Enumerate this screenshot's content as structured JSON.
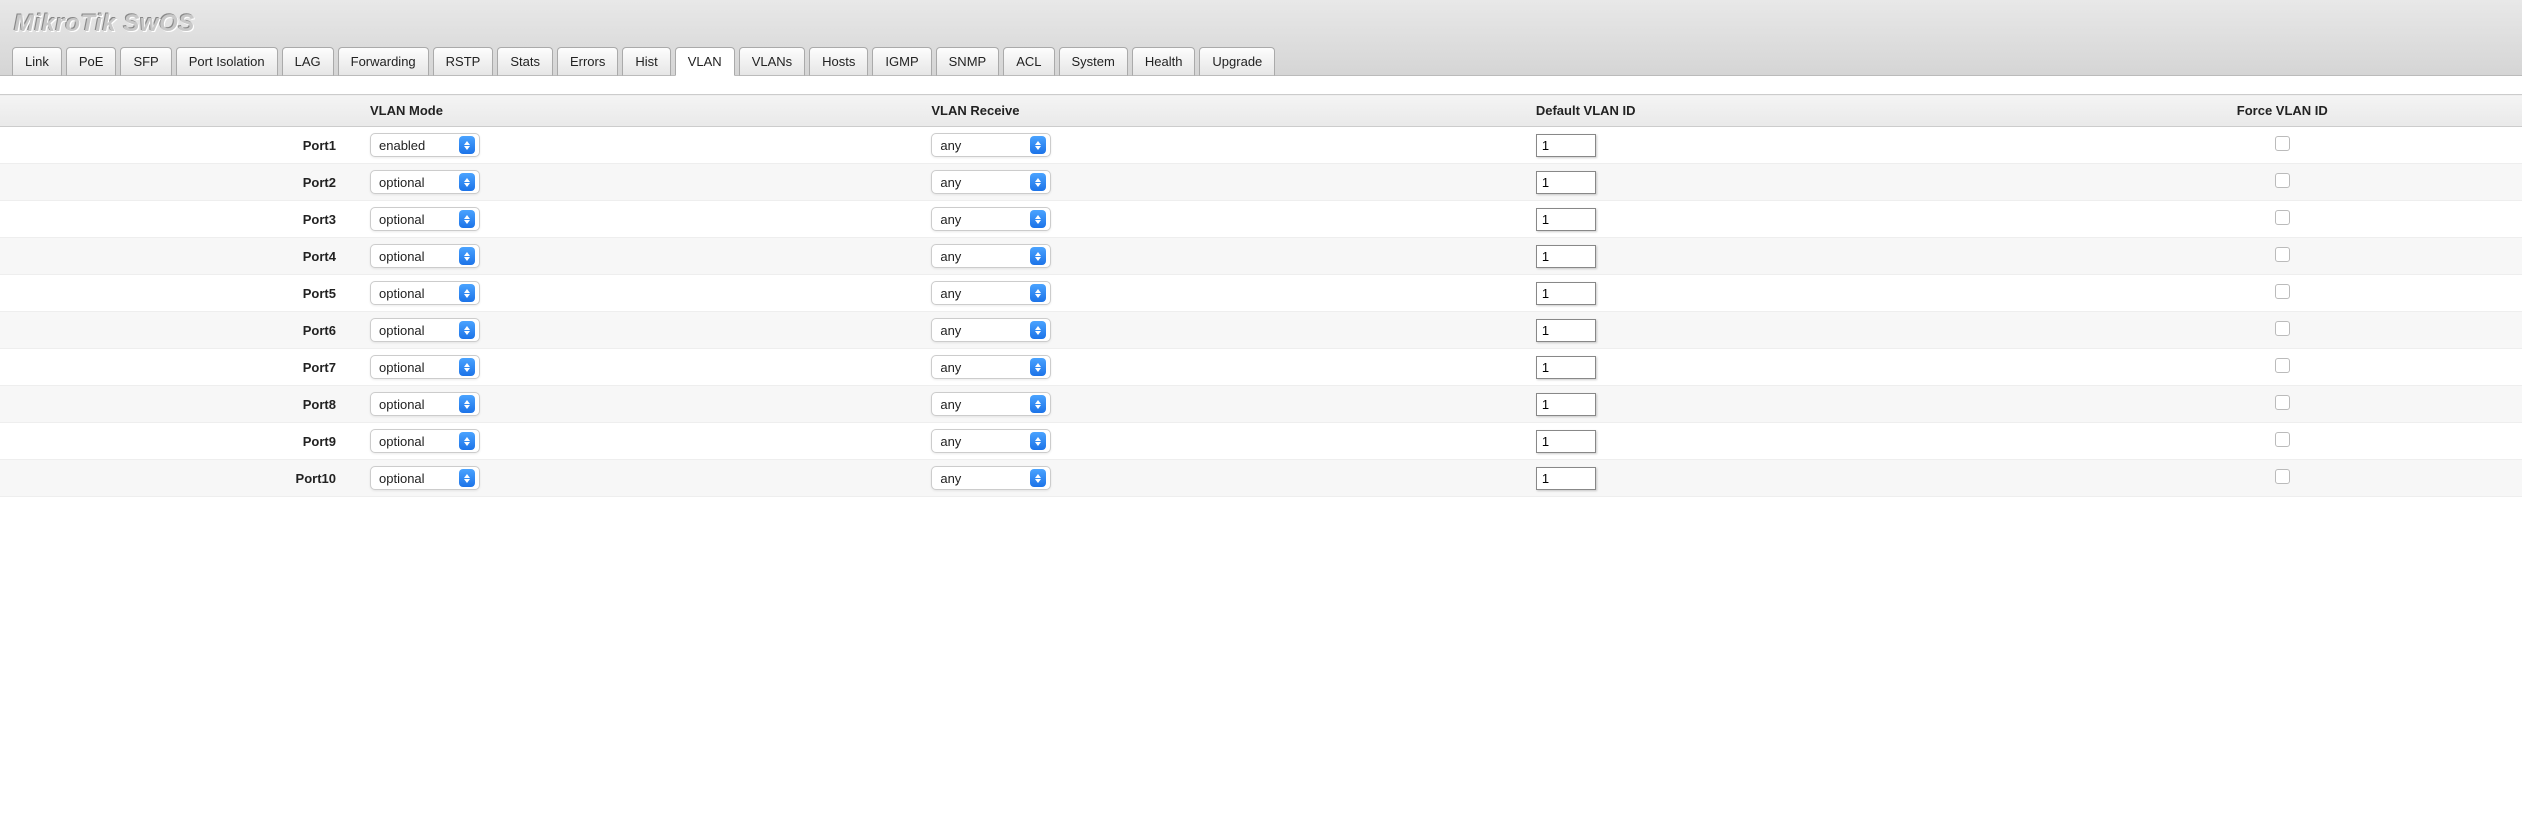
{
  "app_title": "MikroTik SwOS",
  "tabs": [
    "Link",
    "PoE",
    "SFP",
    "Port Isolation",
    "LAG",
    "Forwarding",
    "RSTP",
    "Stats",
    "Errors",
    "Hist",
    "VLAN",
    "VLANs",
    "Hosts",
    "IGMP",
    "SNMP",
    "ACL",
    "System",
    "Health",
    "Upgrade"
  ],
  "active_tab": "VLAN",
  "columns": {
    "vlan_mode": "VLAN Mode",
    "vlan_receive": "VLAN Receive",
    "default_vlan_id": "Default VLAN ID",
    "force_vlan_id": "Force VLAN ID"
  },
  "rows": [
    {
      "port": "Port1",
      "mode": "enabled",
      "receive": "any",
      "vlan_id": "1",
      "force": false
    },
    {
      "port": "Port2",
      "mode": "optional",
      "receive": "any",
      "vlan_id": "1",
      "force": false
    },
    {
      "port": "Port3",
      "mode": "optional",
      "receive": "any",
      "vlan_id": "1",
      "force": false
    },
    {
      "port": "Port4",
      "mode": "optional",
      "receive": "any",
      "vlan_id": "1",
      "force": false
    },
    {
      "port": "Port5",
      "mode": "optional",
      "receive": "any",
      "vlan_id": "1",
      "force": false
    },
    {
      "port": "Port6",
      "mode": "optional",
      "receive": "any",
      "vlan_id": "1",
      "force": false
    },
    {
      "port": "Port7",
      "mode": "optional",
      "receive": "any",
      "vlan_id": "1",
      "force": false
    },
    {
      "port": "Port8",
      "mode": "optional",
      "receive": "any",
      "vlan_id": "1",
      "force": false
    },
    {
      "port": "Port9",
      "mode": "optional",
      "receive": "any",
      "vlan_id": "1",
      "force": false
    },
    {
      "port": "Port10",
      "mode": "optional",
      "receive": "any",
      "vlan_id": "1",
      "force": false
    }
  ]
}
